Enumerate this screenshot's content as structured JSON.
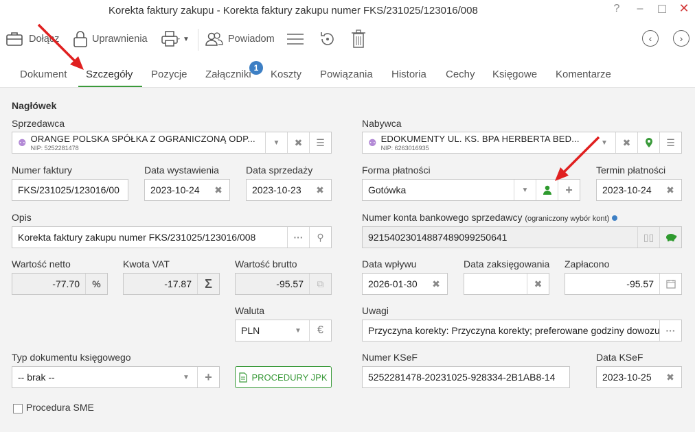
{
  "window": {
    "title": "Korekta faktury zakupu - Korekta faktury zakupu numer FKS/231025/123016/008"
  },
  "toolbar": {
    "attach": "Dołącz",
    "permissions": "Uprawnienia",
    "notify": "Powiadom"
  },
  "tabs": [
    "Dokument",
    "Szczegóły",
    "Pozycje",
    "Załączniki",
    "Koszty",
    "Powiązania",
    "Historia",
    "Cechy",
    "Księgowe",
    "Komentarze"
  ],
  "attachments_badge": "1",
  "header": {
    "section": "Nagłówek",
    "seller_label": "Sprzedawca",
    "seller_name": "ORANGE POLSKA SPÓŁKA Z OGRANICZONĄ ODP...",
    "seller_nip": "NIP: 5252281478",
    "buyer_label": "Nabywca",
    "buyer_name": "EDOKUMENTY UL. KS. BPA HERBERTA BED...",
    "buyer_nip": "NIP: 6263016935",
    "invoice_no_label": "Numer faktury",
    "invoice_no": "FKS/231025/123016/00",
    "issue_date_label": "Data wystawienia",
    "issue_date": "2023-10-24",
    "sale_date_label": "Data sprzedaży",
    "sale_date": "2023-10-23",
    "payment_form_label": "Forma płatności",
    "payment_form": "Gotówka",
    "payment_due_label": "Termin płatności",
    "payment_due": "2023-10-24",
    "desc_label": "Opis",
    "desc": "Korekta faktury zakupu numer FKS/231025/123016/008",
    "bank_label": "Numer konta bankowego sprzedawcy",
    "bank_note": "(ograniczony wybór kont)",
    "bank": "92154023014887489099250641",
    "net_label": "Wartość netto",
    "net": "-77.70",
    "vat_label": "Kwota VAT",
    "vat": "-17.87",
    "gross_label": "Wartość brutto",
    "gross": "-95.57",
    "receipt_label": "Data wpływu",
    "receipt": "2026-01-30",
    "posting_label": "Data zaksięgowania",
    "posting": "",
    "paid_label": "Zapłacono",
    "paid": "-95.57",
    "currency_label": "Waluta",
    "currency": "PLN",
    "notes_label": "Uwagi",
    "notes": "Przyczyna korekty: Przyczyna korekty; preferowane godziny dowozu",
    "doctype_label": "Typ dokumentu księgowego",
    "doctype": "-- brak --",
    "jpk": "PROCEDURY JPK",
    "ksef_no_label": "Numer KSeF",
    "ksef_no": "5252281478-20231025-928334-2B1AB8-14",
    "ksef_date_label": "Data KSeF",
    "ksef_date": "2023-10-25",
    "sme": "Procedura SME"
  },
  "colors": {
    "accent": "#3a9a3a",
    "badge": "#3d7fc4",
    "arrow": "#e02020",
    "close": "#d33a3a"
  },
  "icons": [
    "help-icon",
    "minimize-icon",
    "maximize-icon",
    "close-icon",
    "briefcase-icon",
    "lock-icon",
    "printer-icon",
    "people-icon",
    "menu-icon",
    "refresh-icon",
    "trash-icon",
    "chevron-left-icon",
    "chevron-right-icon",
    "person-icon",
    "pin-icon",
    "piggy-bank-icon",
    "calendar-icon",
    "sigma-icon",
    "euro-icon",
    "document-icon"
  ]
}
